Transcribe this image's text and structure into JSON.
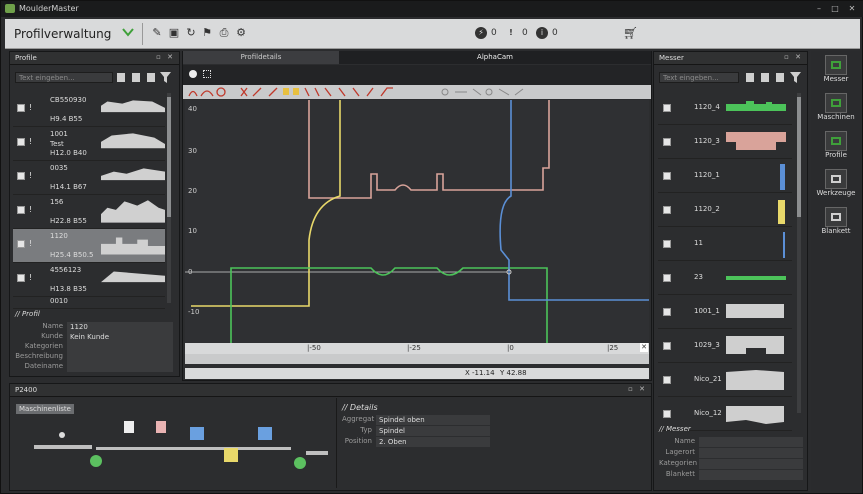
{
  "window": {
    "title": "MoulderMaster",
    "min": "–",
    "max": "□",
    "close": "✕"
  },
  "header": {
    "title": "Profilverwaltung",
    "status": [
      {
        "icon": "⚡",
        "count": "0"
      },
      {
        "icon": "!",
        "count": "0"
      },
      {
        "icon": "i",
        "count": "0"
      }
    ]
  },
  "profile_panel": {
    "title": "Profile",
    "search_placeholder": "Text eingeben...",
    "items": [
      {
        "l1": "CB550930",
        "l2": "",
        "l3": "H9.4 B55"
      },
      {
        "l1": "1001",
        "l2": "Test",
        "l3": "H12.0 B40"
      },
      {
        "l1": "0035",
        "l2": "",
        "l3": "H14.1 B67"
      },
      {
        "l1": "156",
        "l2": "",
        "l3": "H22.8 B55"
      },
      {
        "l1": "1120",
        "l2": "",
        "l3": "H25.4 B50.5"
      },
      {
        "l1": "4556123",
        "l2": "",
        "l3": "H13.8 B35"
      },
      {
        "l1": "0010",
        "l2": "",
        "l3": ""
      }
    ],
    "selected_index": 4,
    "section_title": "// Profil",
    "fields": [
      {
        "label": "Name",
        "value": "1120"
      },
      {
        "label": "Kunde",
        "value": "Kein Kunde"
      },
      {
        "label": "Kategorien",
        "value": ""
      },
      {
        "label": "Beschreibung",
        "value": ""
      },
      {
        "label": "Dateiname",
        "value": ""
      }
    ]
  },
  "center": {
    "tabs": [
      "Profildetails",
      "AlphaCam"
    ],
    "active_tab": "AlphaCam",
    "axis_y": [
      "40",
      "30",
      "20",
      "10",
      "0",
      "-10"
    ],
    "axis_x": [
      "|-50",
      "|-25",
      "|0",
      "|25"
    ],
    "status_x": "X -11.14",
    "status_y": "Y 42.88"
  },
  "messer_panel": {
    "title": "Messer",
    "search_placeholder": "Text eingeben...",
    "items": [
      {
        "name": "1120_4",
        "color": "#4cc35a"
      },
      {
        "name": "1120_3",
        "color": "#d9a39a"
      },
      {
        "name": "1120_1",
        "color": "#5b8fd6"
      },
      {
        "name": "1120_2",
        "color": "#e8d86a"
      },
      {
        "name": "11",
        "color": "#5b8fd6"
      },
      {
        "name": "23",
        "color": "#4cc35a"
      },
      {
        "name": "1001_1",
        "color": "#cfcfcf"
      },
      {
        "name": "1029_3",
        "color": "#cfcfcf"
      },
      {
        "name": "Nico_21",
        "color": "#cfcfcf"
      },
      {
        "name": "Nico_12",
        "color": "#cfcfcf"
      }
    ],
    "section_title": "// Messer",
    "fields": [
      {
        "label": "Name"
      },
      {
        "label": "Lagerort"
      },
      {
        "label": "Kategorien"
      },
      {
        "label": "Blankett"
      }
    ]
  },
  "right_strip": [
    "Messer",
    "Maschinen",
    "Profile",
    "Werkzeuge",
    "Blankett"
  ],
  "bottom": {
    "title": "P2400",
    "machine_list_btn": "Maschinenliste",
    "details_title": "// Details",
    "details": [
      {
        "label": "Aggregat",
        "value": "Spindel oben"
      },
      {
        "label": "Typ",
        "value": "Spindel"
      },
      {
        "label": "Position",
        "value": "2. Oben"
      }
    ]
  },
  "colors": {
    "green": "#4cc35a",
    "pink": "#d9a39a",
    "blue": "#5b8fd6",
    "yellow": "#e8d86a",
    "canvas": "#2f3033"
  }
}
